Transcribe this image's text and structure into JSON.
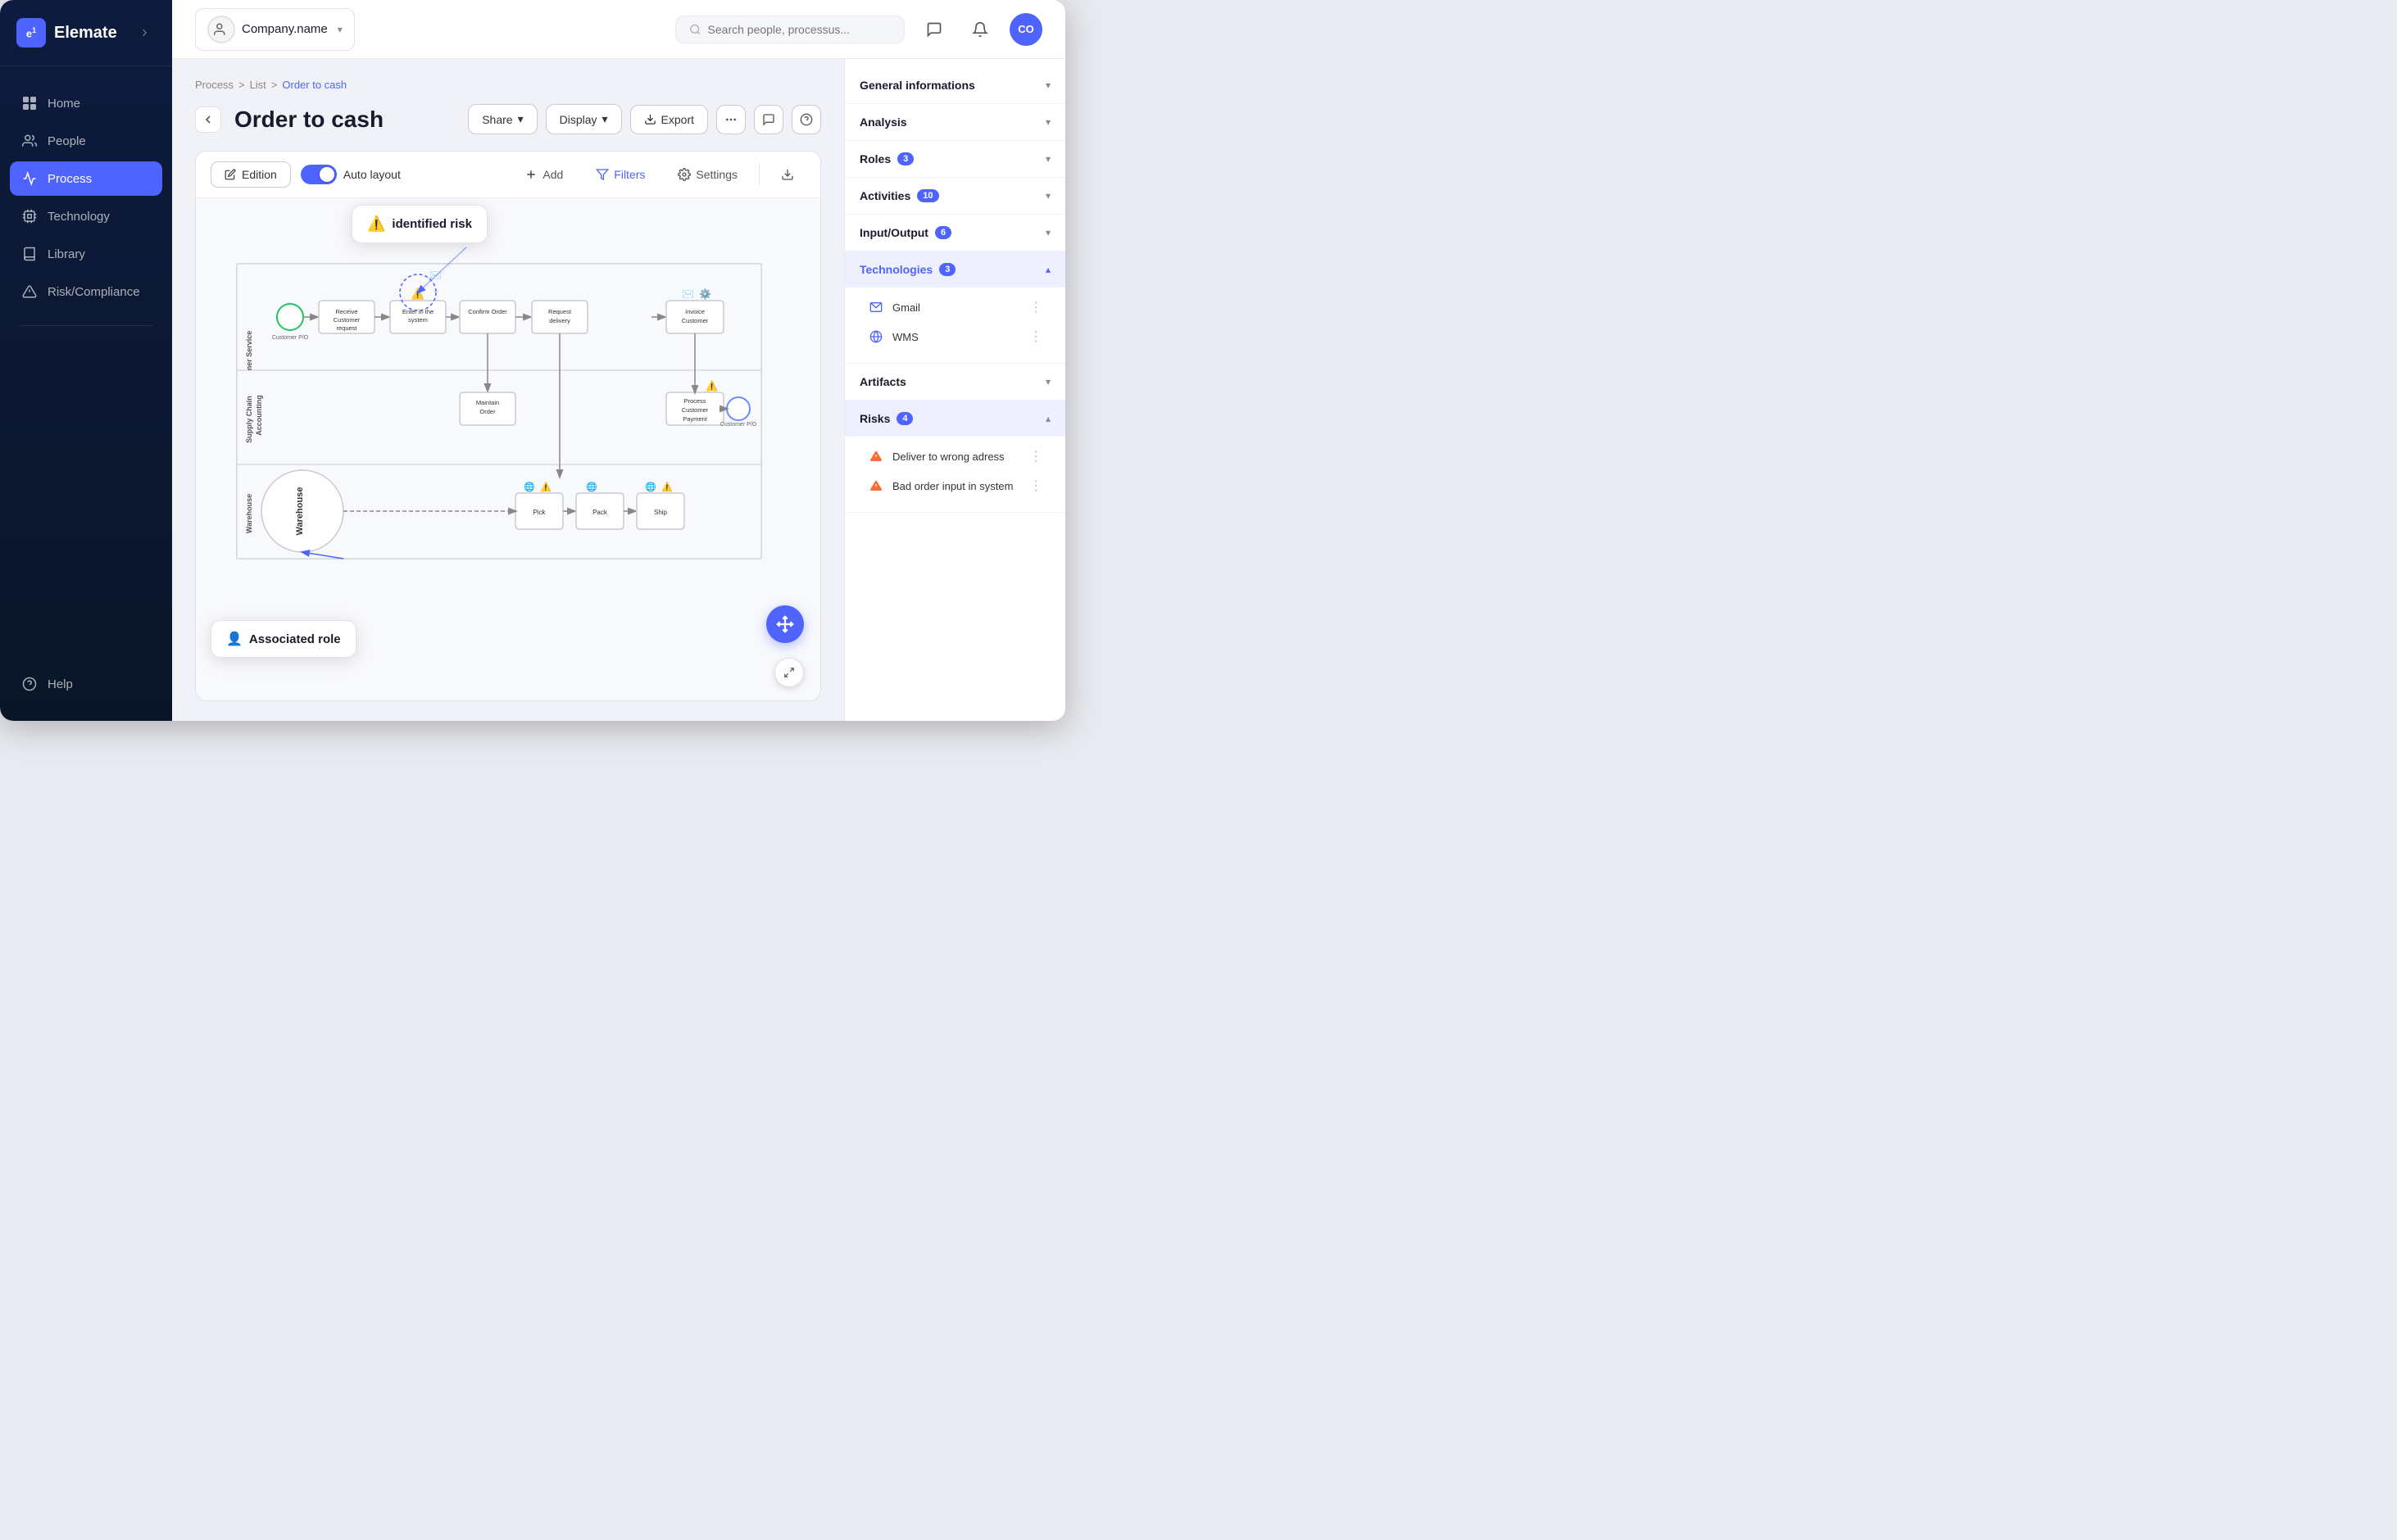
{
  "app": {
    "name": "Elemate",
    "logo_letter": "e1"
  },
  "topbar": {
    "company_name": "Company.name",
    "search_placeholder": "Search people, processus...",
    "user_initials": "CO"
  },
  "sidebar": {
    "items": [
      {
        "id": "home",
        "label": "Home",
        "icon": "grid"
      },
      {
        "id": "people",
        "label": "People",
        "icon": "users"
      },
      {
        "id": "process",
        "label": "Process",
        "icon": "flow",
        "active": true
      },
      {
        "id": "technology",
        "label": "Technology",
        "icon": "cpu"
      },
      {
        "id": "library",
        "label": "Library",
        "icon": "book"
      },
      {
        "id": "risk",
        "label": "Risk/Compliance",
        "icon": "warning"
      }
    ],
    "help": "Help"
  },
  "breadcrumb": {
    "items": [
      "Process",
      "List",
      "Order to cash"
    ],
    "active_index": 2
  },
  "page": {
    "title": "Order to cash"
  },
  "header_buttons": {
    "share": "Share",
    "display": "Display",
    "export": "Export"
  },
  "canvas_toolbar": {
    "edition_label": "Edition",
    "auto_layout_label": "Auto layout",
    "add_label": "Add",
    "filters_label": "Filters",
    "settings_label": "Settings"
  },
  "callouts": {
    "risk": {
      "label": "identified risk",
      "icon": "⚠️"
    },
    "role": {
      "label": "Associated role",
      "icon": "👤"
    }
  },
  "diagram": {
    "swimlanes": [
      {
        "label": "Customer Service"
      },
      {
        "label": "Supply Chain"
      },
      {
        "label": "Warehouse"
      }
    ],
    "nodes": [
      "Receive Customer request",
      "Enter in the system",
      "Confirm Order",
      "Request delivery",
      "Invoice Customer",
      "Maintain Order",
      "Process Customer Payment",
      "Pick",
      "Pack",
      "Ship"
    ]
  },
  "right_panel": {
    "sections": [
      {
        "id": "general",
        "label": "General informations",
        "open": false,
        "badge": null
      },
      {
        "id": "analysis",
        "label": "Analysis",
        "open": false,
        "badge": null
      },
      {
        "id": "roles",
        "label": "Roles",
        "open": false,
        "badge": "3"
      },
      {
        "id": "activities",
        "label": "Activities",
        "open": false,
        "badge": "10"
      },
      {
        "id": "inputoutput",
        "label": "Input/Output",
        "open": false,
        "badge": "6"
      },
      {
        "id": "technologies",
        "label": "Technologies",
        "open": true,
        "badge": "3",
        "items": [
          {
            "name": "Gmail",
            "icon": "email"
          },
          {
            "name": "WMS",
            "icon": "globe"
          }
        ]
      },
      {
        "id": "artifacts",
        "label": "Artifacts",
        "open": false,
        "badge": null
      },
      {
        "id": "risks",
        "label": "Risks",
        "open": true,
        "badge": "4",
        "items": [
          {
            "name": "Deliver to wrong adress",
            "icon": "warning"
          },
          {
            "name": "Bad order input in system",
            "icon": "warning"
          }
        ]
      }
    ]
  }
}
